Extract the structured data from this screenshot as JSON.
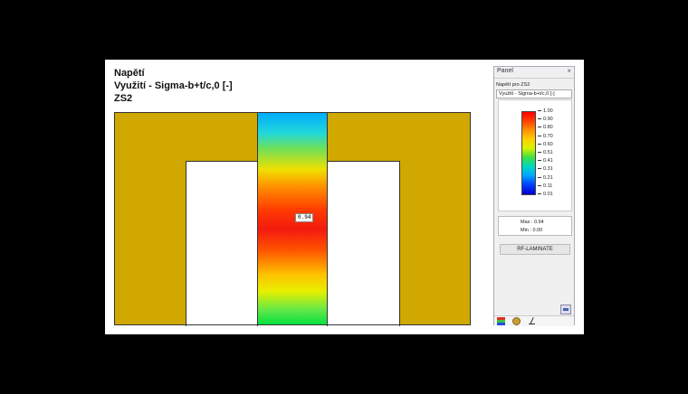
{
  "header": {
    "line1": "Napětí",
    "line2": "Využití - Sigma-b+t/c,0 [-]",
    "line3": "ZS2"
  },
  "model": {
    "value_label": "0.94"
  },
  "panel": {
    "title": "Panel",
    "close": "×",
    "sub1": "Napětí pro ZS2",
    "sub2": "Využití - Sigma-b+t/c,0 [-]",
    "legend_ticks": [
      "1.00",
      "0.90",
      "0.80",
      "0.70",
      "0.60",
      "0.51",
      "0.41",
      "0.31",
      "0.21",
      "0.11",
      "0.01"
    ],
    "max_label": "Max  :  0.94",
    "min_label": "Min  :  0.00",
    "button_label": "RF-LAMINATE"
  },
  "colors": {
    "model_gold": "#d0a800",
    "accent_red": "#ff0000",
    "accent_blue": "#0000d0"
  }
}
